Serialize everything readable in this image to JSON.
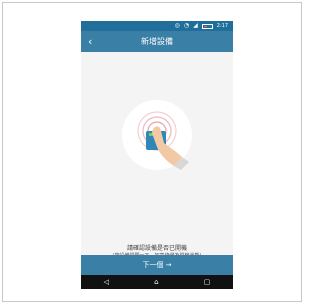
{
  "status_bar": {
    "time": "2:17",
    "icons": [
      "location-icon",
      "wifi-icon",
      "signal-icon",
      "battery-icon"
    ]
  },
  "app_bar": {
    "title": "新增設備",
    "back_icon": "chevron-left-icon"
  },
  "illustration": {
    "name": "finger-pressing-device-with-signal-waves",
    "colors": {
      "circle": "#ffffff",
      "waves": "#e8a0a8",
      "device": "#2f86b8",
      "hand": "#f3c9a5",
      "cuff": "#d7d7d7"
    }
  },
  "instructions": {
    "line1": "請確認設備是否已開機",
    "line2": "(按設備開關一下，如亮綠燈為開機狀態)"
  },
  "next_button": {
    "label": "下一個 →"
  },
  "nav_bar": {
    "icons": [
      "back-triangle-icon",
      "home-icon",
      "recents-icon"
    ]
  },
  "colors": {
    "primary": "#3a7fa6",
    "status_bar": "#1f6f9a",
    "background": "#f4f4f4"
  }
}
